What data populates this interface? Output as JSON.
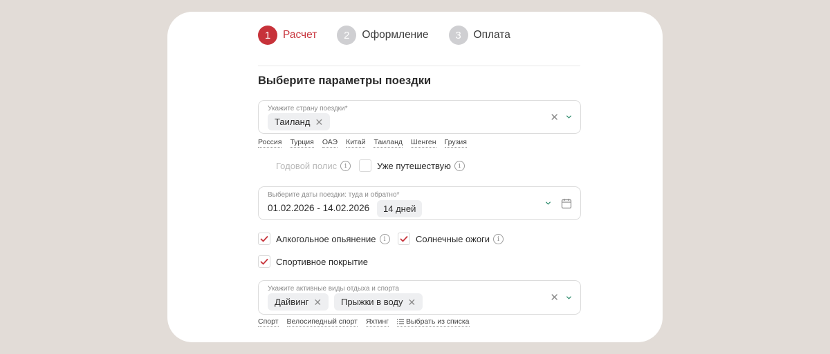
{
  "steps": [
    {
      "num": "1",
      "label": "Расчет"
    },
    {
      "num": "2",
      "label": "Оформление"
    },
    {
      "num": "3",
      "label": "Оплата"
    }
  ],
  "section_title": "Выберите параметры поездки",
  "country_field": {
    "label": "Укажите страну поездки*",
    "chip": "Таиланд",
    "suggestions": [
      "Россия",
      "Турция",
      "ОАЭ",
      "Китай",
      "Таиланд",
      "Шенген",
      "Грузия"
    ]
  },
  "policy_options": {
    "annual_label": "Годовой полис",
    "traveling_label": "Уже путешествую"
  },
  "dates_field": {
    "label": "Выберите даты поездки: туда и обратно*",
    "value": "01.02.2026 - 14.02.2026",
    "duration": "14 дней"
  },
  "options": {
    "alcohol_label": "Алкогольное опьянение",
    "sunburn_label": "Солнечные ожоги",
    "sport_label": "Спортивное покрытие"
  },
  "activities_field": {
    "label": "Укажите активные виды отдыха и спорта",
    "chips": [
      "Дайвинг",
      "Прыжки в воду"
    ],
    "suggestions": [
      "Спорт",
      "Велосипедный спорт",
      "Яхтинг"
    ],
    "select_from_list": "Выбрать из списка"
  },
  "colors": {
    "accent": "#c7323a",
    "inactive_step": "#cfcfd2",
    "background": "#e2dcd7"
  }
}
